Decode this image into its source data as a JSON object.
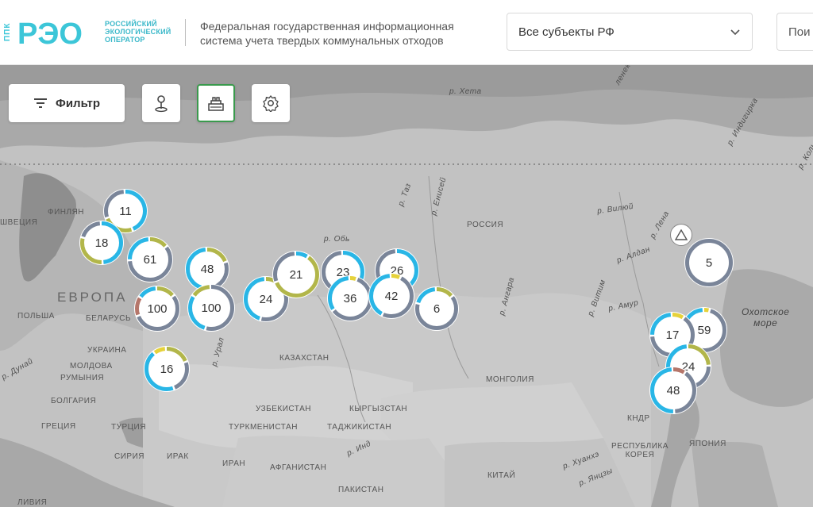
{
  "header": {
    "logo_side_text": "ППК",
    "logo_mark": "РЭО",
    "logo_text": "РОССИЙСКИЙ\nЭКОЛОГИЧЕСКИЙ\nОПЕРАТОР",
    "system_title": "Федеральная государственная информационная\nсистема учета твердых коммунальных отходов",
    "region_select_value": "Все субъекты РФ",
    "search_text": "Пои"
  },
  "toolbar": {
    "filter_label": "Фильтр",
    "icons": [
      "filter-icon",
      "map-pin-icon",
      "layers-icon",
      "settings-icon"
    ]
  },
  "colors": {
    "blue": "#29b6e6",
    "olive": "#b2b64a",
    "gray": "#7a8599",
    "yellow": "#e6d23a",
    "brown": "#b5766a",
    "accent_green": "#3a9a4d"
  },
  "map_labels": {
    "evropa": "ЕВРОПА",
    "finlyandiya": "ФИНЛЯН",
    "shveciya": "ШВЕЦИЯ",
    "polsha": "ПОЛЬША",
    "belarus": "БЕЛАРУСЬ",
    "ukraina": "УКРАИНА",
    "moldova": "МОЛДОВА",
    "rumyniya": "РУМЫНИЯ",
    "bolgariya": "БОЛГАРИЯ",
    "greciya": "ГРЕЦИЯ",
    "turciya": "ТУРЦИЯ",
    "siriya": "СИРИЯ",
    "irak": "ИРАК",
    "iran": "ИРАН",
    "liviya": "ЛИВИЯ",
    "rossiya": "РОССИЯ",
    "kazakhstan": "КАЗАХСТАН",
    "uzbekistan": "УЗБЕКИСТАН",
    "kyrgyzstan": "КЫРГЫЗСТАН",
    "turkmenistan": "ТУРКМЕНИСТАН",
    "tadzhikistan": "ТАДЖИКИСТАН",
    "afganistan": "АФГАНИСТАН",
    "pakistan": "ПАКИСТАН",
    "mongoliya": "МОНГОЛИЯ",
    "kitai": "КИТАЙ",
    "kndr": "КНДР",
    "respublika_koreya": "РЕСПУБЛИКА\nКОРЕЯ",
    "yaponiya": "ЯПОНИЯ",
    "okhotskoe_more": "Охотское\nморе",
    "r_kheta": "р. Хета",
    "r_ob": "р. Обь",
    "r_taz": "р. Таз",
    "r_enisei": "р. Енисей",
    "r_vilyui": "р. Вилюй",
    "r_lena": "р. Лена",
    "r_aldan": "р. Алдан",
    "r_amur": "р. Амур",
    "r_angara": "р. Ангара",
    "r_vitim": "р. Витим",
    "r_ural": "р. Урал",
    "r_dunai": "р. Дунай",
    "r_ind": "р. Инд",
    "r_khuanhe": "р. Хуанхэ",
    "r_yanczy": "р. Янцзы",
    "r_indigirka": "р. Индигирка",
    "r_kolyma": "р. Колы",
    "r_lenek": "ленек"
  },
  "clusters": [
    {
      "count": "11",
      "segments": [
        [
          "#29b6e6",
          0.45
        ],
        [
          "#b2b64a",
          0.25
        ],
        [
          "#7a8599",
          0.3
        ]
      ]
    },
    {
      "count": "18",
      "segments": [
        [
          "#29b6e6",
          0.5
        ],
        [
          "#b2b64a",
          0.3
        ],
        [
          "#7a8599",
          0.2
        ]
      ]
    },
    {
      "count": "61",
      "segments": [
        [
          "#b2b64a",
          0.15
        ],
        [
          "#7a8599",
          0.6
        ],
        [
          "#29b6e6",
          0.25
        ]
      ]
    },
    {
      "count": "48",
      "segments": [
        [
          "#b2b64a",
          0.2
        ],
        [
          "#7a8599",
          0.35
        ],
        [
          "#29b6e6",
          0.45
        ]
      ]
    },
    {
      "count": "100",
      "segments": [
        [
          "#b2b64a",
          0.15
        ],
        [
          "#7a8599",
          0.55
        ],
        [
          "#b5766a",
          0.15
        ],
        [
          "#29b6e6",
          0.15
        ]
      ]
    },
    {
      "count": "100",
      "segments": [
        [
          "#7a8599",
          0.55
        ],
        [
          "#29b6e6",
          0.3
        ],
        [
          "#b2b64a",
          0.15
        ]
      ]
    },
    {
      "count": "24",
      "segments": [
        [
          "#b2b64a",
          0.2
        ],
        [
          "#7a8599",
          0.35
        ],
        [
          "#29b6e6",
          0.45
        ]
      ]
    },
    {
      "count": "21",
      "segments": [
        [
          "#29b6e6",
          0.1
        ],
        [
          "#b2b64a",
          0.6
        ],
        [
          "#7a8599",
          0.3
        ]
      ]
    },
    {
      "count": "23",
      "segments": [
        [
          "#29b6e6",
          0.45
        ],
        [
          "#7a8599",
          0.55
        ]
      ]
    },
    {
      "count": "36",
      "segments": [
        [
          "#e6d23a",
          0.06
        ],
        [
          "#7a8599",
          0.6
        ],
        [
          "#29b6e6",
          0.34
        ]
      ]
    },
    {
      "count": "26",
      "segments": [
        [
          "#29b6e6",
          0.5
        ],
        [
          "#7a8599",
          0.5
        ]
      ]
    },
    {
      "count": "42",
      "segments": [
        [
          "#e6d23a",
          0.08
        ],
        [
          "#7a8599",
          0.5
        ],
        [
          "#29b6e6",
          0.42
        ]
      ]
    },
    {
      "count": "6",
      "segments": [
        [
          "#b2b64a",
          0.15
        ],
        [
          "#7a8599",
          0.65
        ],
        [
          "#29b6e6",
          0.2
        ]
      ]
    },
    {
      "count": "16",
      "segments": [
        [
          "#b2b64a",
          0.2
        ],
        [
          "#7a8599",
          0.25
        ],
        [
          "#29b6e6",
          0.45
        ],
        [
          "#e6d23a",
          0.1
        ]
      ]
    },
    {
      "count": "5",
      "segments": [
        [
          "#7a8599",
          1.0
        ]
      ]
    },
    {
      "count": "59",
      "segments": [
        [
          "#e6d23a",
          0.05
        ],
        [
          "#7a8599",
          0.55
        ],
        [
          "#29b6e6",
          0.4
        ]
      ]
    },
    {
      "count": "17",
      "segments": [
        [
          "#e6d23a",
          0.1
        ],
        [
          "#7a8599",
          0.65
        ],
        [
          "#29b6e6",
          0.25
        ]
      ]
    },
    {
      "count": "24",
      "segments": [
        [
          "#b2b64a",
          0.25
        ],
        [
          "#7a8599",
          0.45
        ],
        [
          "#29b6e6",
          0.3
        ]
      ]
    },
    {
      "count": "48",
      "segments": [
        [
          "#b5766a",
          0.1
        ],
        [
          "#7a8599",
          0.4
        ],
        [
          "#29b6e6",
          0.5
        ]
      ]
    }
  ]
}
